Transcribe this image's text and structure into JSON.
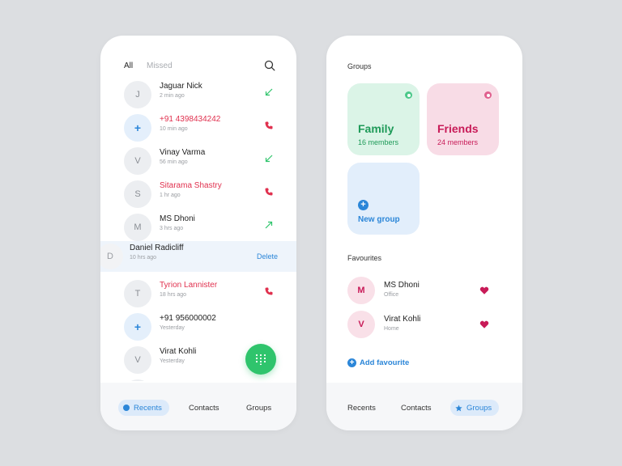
{
  "colors": {
    "accent": "#2b86d8",
    "missed": "#e0304e",
    "incoming": "#2fc46c",
    "fab": "#2fc46c",
    "family_card": "#dbf4e7",
    "friends_card": "#f8dce6",
    "new_group_card": "#e2eefb",
    "heart": "#c81b58"
  },
  "recents_screen": {
    "tabs": [
      {
        "label": "All",
        "active": true
      },
      {
        "label": "Missed",
        "active": false
      }
    ],
    "search_icon": "search-icon",
    "calls": [
      {
        "initial": "J",
        "name": "Jaguar Nick",
        "time": "2 min ago",
        "type": "incoming"
      },
      {
        "initial": "+",
        "name": "+91 4398434242",
        "time": "10 min ago",
        "type": "missed"
      },
      {
        "initial": "V",
        "name": "Vinay Varma",
        "time": "56 min ago",
        "type": "incoming"
      },
      {
        "initial": "S",
        "name": "Sitarama Shastry",
        "time": "1 hr ago",
        "type": "missed"
      },
      {
        "initial": "M",
        "name": "MS Dhoni",
        "time": "3 hrs ago",
        "type": "outgoing"
      },
      {
        "initial": "T",
        "name": "Tyrion Lannister",
        "time": "18 hrs ago",
        "type": "missed"
      },
      {
        "initial": "+",
        "name": "+91 956000002",
        "time": "Yesterday",
        "type": "incoming"
      },
      {
        "initial": "V",
        "name": "Virat Kohli",
        "time": "Yesterday",
        "type": "incoming"
      }
    ],
    "swiped_call": {
      "initial": "D",
      "name": "Daniel Radicliff",
      "time": "10 hrs ago",
      "action": "Delete"
    },
    "partial_row_initial": "M",
    "fab_icon": "dialpad-icon"
  },
  "groups_screen": {
    "groups_title": "Groups",
    "groups": [
      {
        "name": "Family",
        "members": "16 members",
        "color": "#1e9a58",
        "dot": "#4cc88a"
      },
      {
        "name": "Friends",
        "members": "24 members",
        "color": "#c81b58",
        "dot": "#e0608e"
      }
    ],
    "new_group_label": "New group",
    "favourites_title": "Favourites",
    "favourites": [
      {
        "initial": "M",
        "name": "MS Dhoni",
        "label": "Office"
      },
      {
        "initial": "V",
        "name": "Virat Kohli",
        "label": "Home"
      }
    ],
    "add_favourite_label": "Add favourite"
  },
  "nav_left": {
    "items": [
      {
        "label": "Recents",
        "active": true
      },
      {
        "label": "Contacts",
        "active": false
      },
      {
        "label": "Groups",
        "active": false
      }
    ]
  },
  "nav_right": {
    "items": [
      {
        "label": "Recents",
        "active": false
      },
      {
        "label": "Contacts",
        "active": false
      },
      {
        "label": "Groups",
        "active": true
      }
    ]
  }
}
